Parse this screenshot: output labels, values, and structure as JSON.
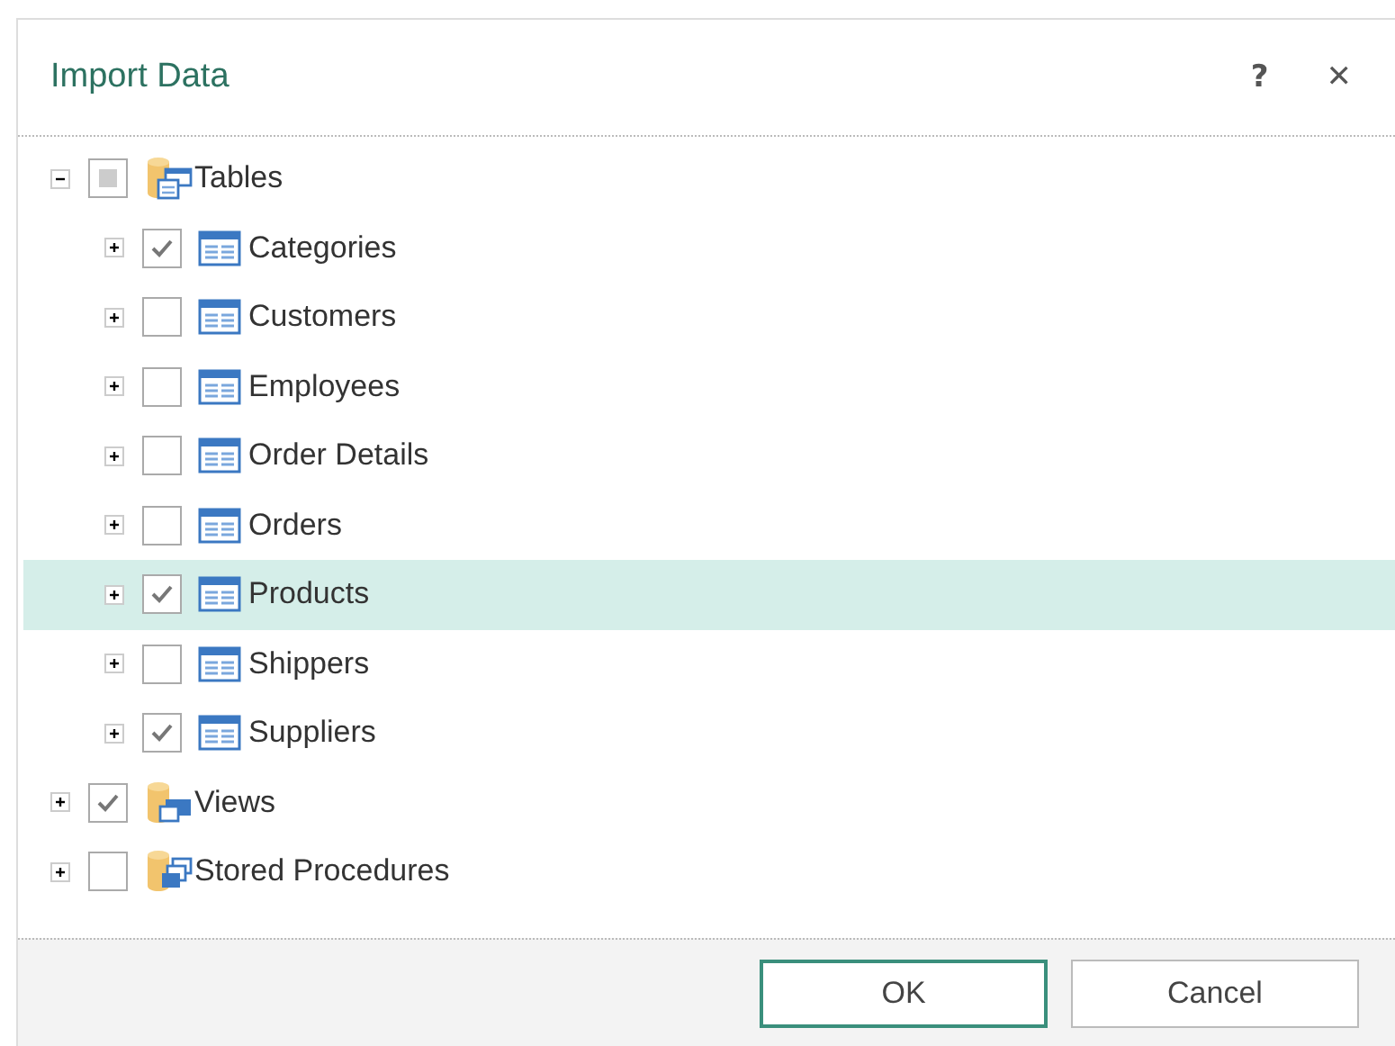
{
  "window": {
    "title": "Import Data",
    "help": "?",
    "close": "✕"
  },
  "tree": [
    {
      "label": "Tables",
      "kind": "tables",
      "expanded": true,
      "checked": false,
      "partial": true,
      "selected": false,
      "children": [
        {
          "label": "Categories",
          "kind": "table",
          "expanded": false,
          "checked": true,
          "selected": false
        },
        {
          "label": "Customers",
          "kind": "table",
          "expanded": false,
          "checked": false,
          "selected": false
        },
        {
          "label": "Employees",
          "kind": "table",
          "expanded": false,
          "checked": false,
          "selected": false
        },
        {
          "label": "Order Details",
          "kind": "table",
          "expanded": false,
          "checked": false,
          "selected": false
        },
        {
          "label": "Orders",
          "kind": "table",
          "expanded": false,
          "checked": false,
          "selected": false
        },
        {
          "label": "Products",
          "kind": "table",
          "expanded": false,
          "checked": true,
          "selected": true
        },
        {
          "label": "Shippers",
          "kind": "table",
          "expanded": false,
          "checked": false,
          "selected": false
        },
        {
          "label": "Suppliers",
          "kind": "table",
          "expanded": false,
          "checked": true,
          "selected": false
        }
      ]
    },
    {
      "label": "Views",
      "kind": "views",
      "expanded": false,
      "checked": true,
      "selected": false
    },
    {
      "label": "Stored Procedures",
      "kind": "procedures",
      "expanded": false,
      "checked": false,
      "selected": false
    }
  ],
  "buttons": [
    {
      "label": "OK",
      "default": true
    },
    {
      "label": "Cancel",
      "default": false
    }
  ]
}
